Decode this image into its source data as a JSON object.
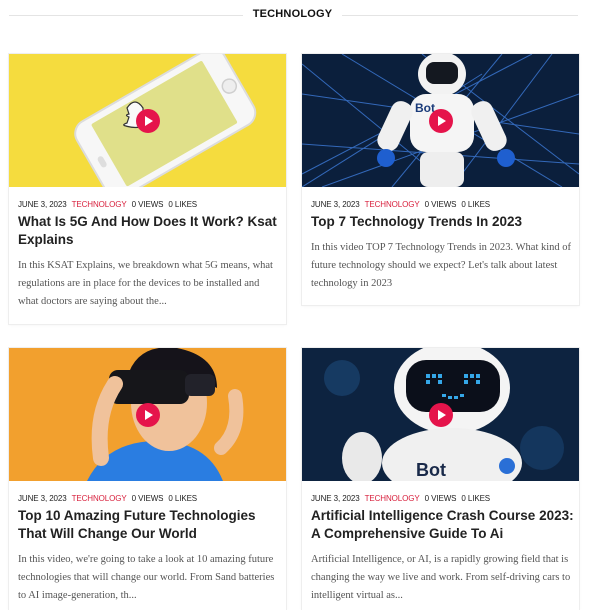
{
  "section": {
    "title": "TECHNOLOGY"
  },
  "cards": [
    {
      "date": "JUNE 3, 2023",
      "category": "TECHNOLOGY",
      "views": "0 VIEWS",
      "likes": "0 LIKES",
      "title": "What Is 5G And How Does It Work? Ksat Explains",
      "excerpt": "In this KSAT Explains, we breakdown what 5G means, what regulations are in place for the devices to be installed and what doctors are saying about the..."
    },
    {
      "date": "JUNE 3, 2023",
      "category": "TECHNOLOGY",
      "views": "0 VIEWS",
      "likes": "0 LIKES",
      "title": "Top 7 Technology Trends In 2023",
      "excerpt": "In this video TOP 7 Technology Trends in 2023. What kind of future technology should we expect? Let's talk about latest technology in 2023"
    },
    {
      "date": "JUNE 3, 2023",
      "category": "TECHNOLOGY",
      "views": "0 VIEWS",
      "likes": "0 LIKES",
      "title": "Top 10 Amazing Future Technologies That Will Change Our World",
      "excerpt": "In this video, we're going to take a look at 10 amazing future technologies that will change our world. From Sand batteries to AI image-generation, th..."
    },
    {
      "date": "JUNE 3, 2023",
      "category": "TECHNOLOGY",
      "views": "0 VIEWS",
      "likes": "0 LIKES",
      "title": "Artificial Intelligence Crash Course 2023: A Comprehensive Guide To Ai",
      "excerpt": "Artificial Intelligence, or AI, is a rapidly growing field that is changing the way we live and work. From self-driving cars to intelligent virtual as..."
    }
  ],
  "thumb_text": {
    "bot": "Bot"
  },
  "colors": {
    "accent": "#d81f3c",
    "play": "#e5144b",
    "phone_bg": "#f5dc3e",
    "vr_bg": "#f2a02e",
    "robot_bg": "#0b1f3c"
  }
}
